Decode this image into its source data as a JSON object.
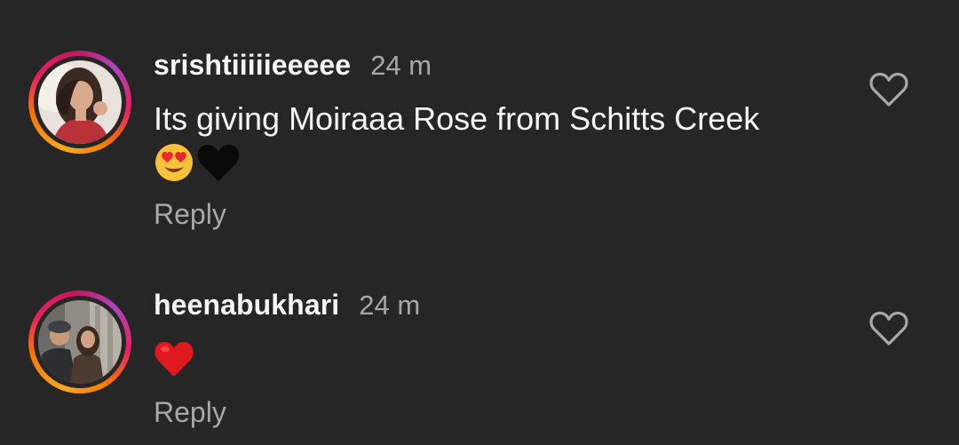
{
  "comments": [
    {
      "username": "srishtiiiiieeeee",
      "time": "24 m",
      "text": "Its giving Moiraaa Rose from Schitts Creek",
      "emojis": [
        "smiling-face-with-heart-eyes",
        "black-heart"
      ],
      "reply_label": "Reply"
    },
    {
      "username": "heenabukhari",
      "time": "24 m",
      "text": "",
      "emojis": [
        "red-heart"
      ],
      "reply_label": "Reply"
    }
  ],
  "colors": {
    "background": "#262626",
    "primary_text": "#f5f5f5",
    "secondary_text": "#a8a8a8",
    "heart_red": "#e0191e"
  },
  "icons": {
    "like": "heart-outline-icon"
  }
}
